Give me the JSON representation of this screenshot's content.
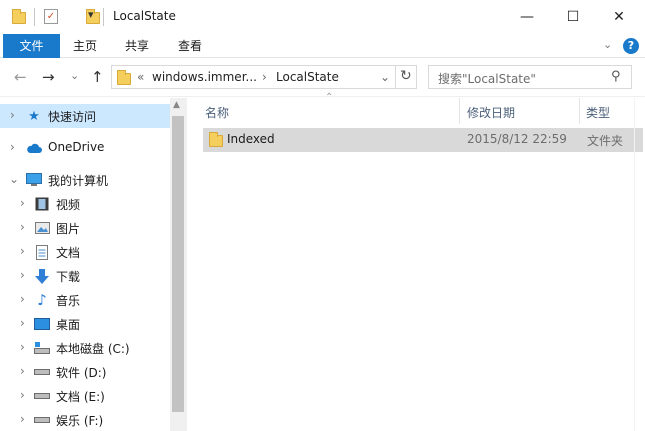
{
  "window": {
    "title": "LocalState",
    "minimize_glyph": "—",
    "maximize_glyph": "☐",
    "close_glyph": "✕"
  },
  "quick_access_toolbar": {
    "dropdown_glyph": "▾"
  },
  "ribbon": {
    "tabs": [
      "文件",
      "主页",
      "共享",
      "查看"
    ],
    "expand_glyph": "⌄",
    "help_glyph": "?"
  },
  "navigation": {
    "back_glyph": "←",
    "forward_glyph": "→",
    "history_glyph": "⌄",
    "up_glyph": "↑",
    "address": {
      "overflow": "«",
      "crumbs": [
        "windows.immer...",
        "LocalState"
      ],
      "crumb_separator": "›",
      "dropdown_glyph": "⌄",
      "refresh_glyph": "↻"
    },
    "search": {
      "placeholder": "搜索\"LocalState\"",
      "icon_glyph": "⚲"
    }
  },
  "nav_pane": {
    "items": [
      {
        "label": "快速访问",
        "icon": "star-icon",
        "selected": true
      },
      {
        "label": "OneDrive",
        "icon": "cloud-icon"
      },
      {
        "label": "我的计算机",
        "icon": "computer-icon",
        "expanded": true
      },
      {
        "label": "视频",
        "icon": "video-icon"
      },
      {
        "label": "图片",
        "icon": "picture-icon"
      },
      {
        "label": "文档",
        "icon": "document-icon"
      },
      {
        "label": "下载",
        "icon": "download-icon"
      },
      {
        "label": "音乐",
        "icon": "music-icon"
      },
      {
        "label": "桌面",
        "icon": "desktop-icon"
      },
      {
        "label": "本地磁盘 (C:)",
        "icon": "system-drive-icon"
      },
      {
        "label": "软件 (D:)",
        "icon": "drive-icon"
      },
      {
        "label": "文档 (E:)",
        "icon": "drive-icon"
      },
      {
        "label": "娱乐 (F:)",
        "icon": "drive-icon"
      }
    ],
    "collapsed_chevron": "›",
    "expanded_chevron": "⌄",
    "scroll_up_glyph": "▲"
  },
  "file_list": {
    "sort_glyph": "⌃",
    "columns": [
      "名称",
      "修改日期",
      "类型"
    ],
    "rows": [
      {
        "name": "Indexed",
        "modified": "2015/8/12 22:59",
        "type": "文件夹"
      }
    ]
  },
  "colors": {
    "accent": "#1979ca",
    "selection": "#cce8ff",
    "row_highlight": "#d9d9d9",
    "folder": "#f5cf5d"
  }
}
